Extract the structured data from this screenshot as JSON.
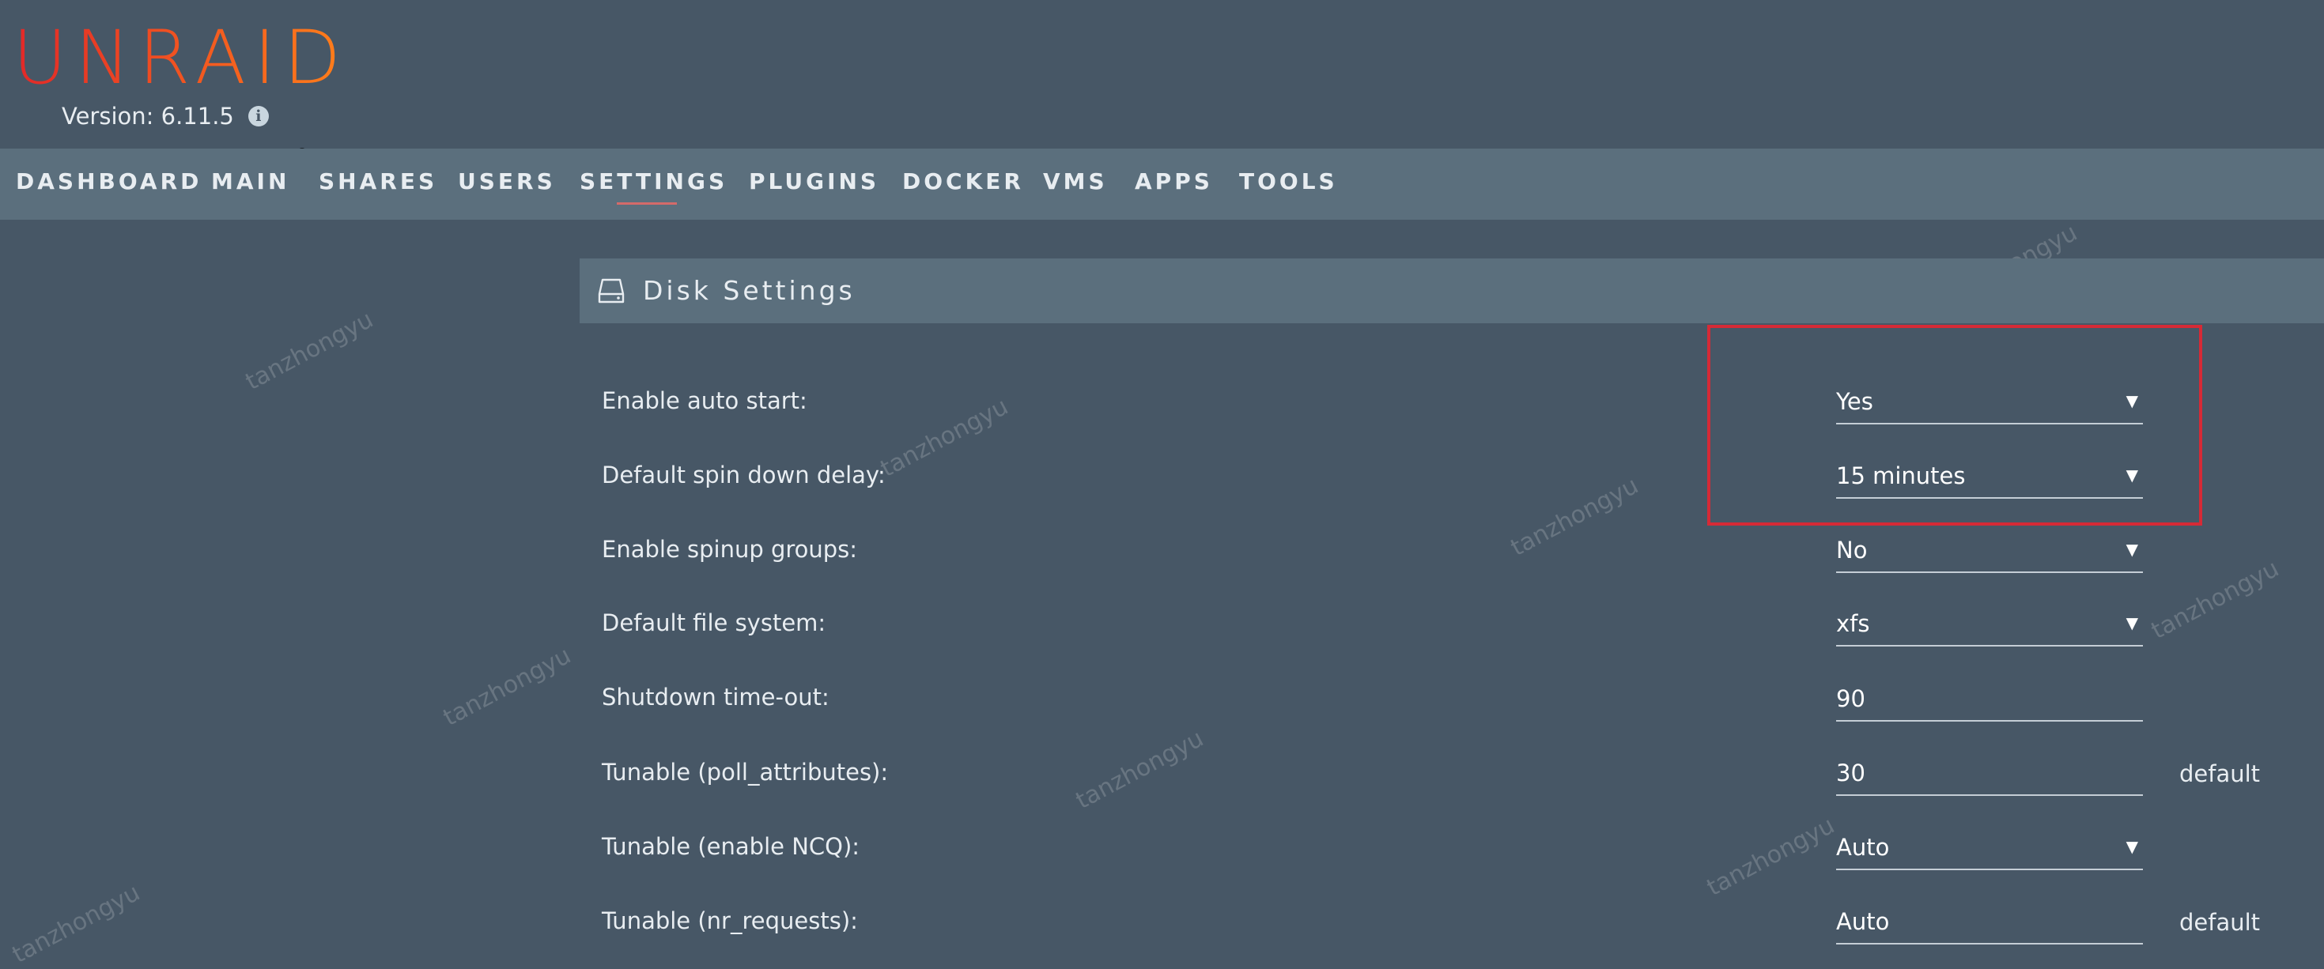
{
  "header": {
    "logo_text": "UNRAID",
    "version_label": "Version: 6.11.5"
  },
  "nav": {
    "items": [
      {
        "label": "DASHBOARD"
      },
      {
        "label": "MAIN"
      },
      {
        "label": "SHARES"
      },
      {
        "label": "USERS"
      },
      {
        "label": "SETTINGS",
        "active": true
      },
      {
        "label": "PLUGINS"
      },
      {
        "label": "DOCKER"
      },
      {
        "label": "VMS"
      },
      {
        "label": "APPS"
      },
      {
        "label": "TOOLS"
      }
    ]
  },
  "panel": {
    "title": "Disk Settings",
    "rows": [
      {
        "label": "Enable auto start:",
        "value": "Yes",
        "type": "select"
      },
      {
        "label": "Default spin down delay:",
        "value": "15 minutes",
        "type": "select"
      },
      {
        "label": "Enable spinup groups:",
        "value": "No",
        "type": "select"
      },
      {
        "label": "Default file system:",
        "value": "xfs",
        "type": "select"
      },
      {
        "label": "Shutdown time-out:",
        "value": "90",
        "type": "input"
      },
      {
        "label": "Tunable (poll_attributes):",
        "value": "30",
        "type": "input",
        "suffix": "default"
      },
      {
        "label": "Tunable (enable NCQ):",
        "value": "Auto",
        "type": "select"
      },
      {
        "label": "Tunable (nr_requests):",
        "value": "Auto",
        "type": "input",
        "suffix": "default"
      }
    ]
  },
  "watermark_text": "tanzhongyu",
  "colors": {
    "background": "#475766",
    "nav_bar": "#5b6f7d",
    "active_underline": "#d46a6a",
    "highlight_border": "#d62a36",
    "logo_start": "#e22828",
    "logo_end": "#ff7f1a"
  },
  "icons": {
    "version_info": "info-icon",
    "panel": "hard-disk-icon",
    "select_arrow": "caret-down-icon",
    "cursor": "magnifier-cursor-icon"
  }
}
